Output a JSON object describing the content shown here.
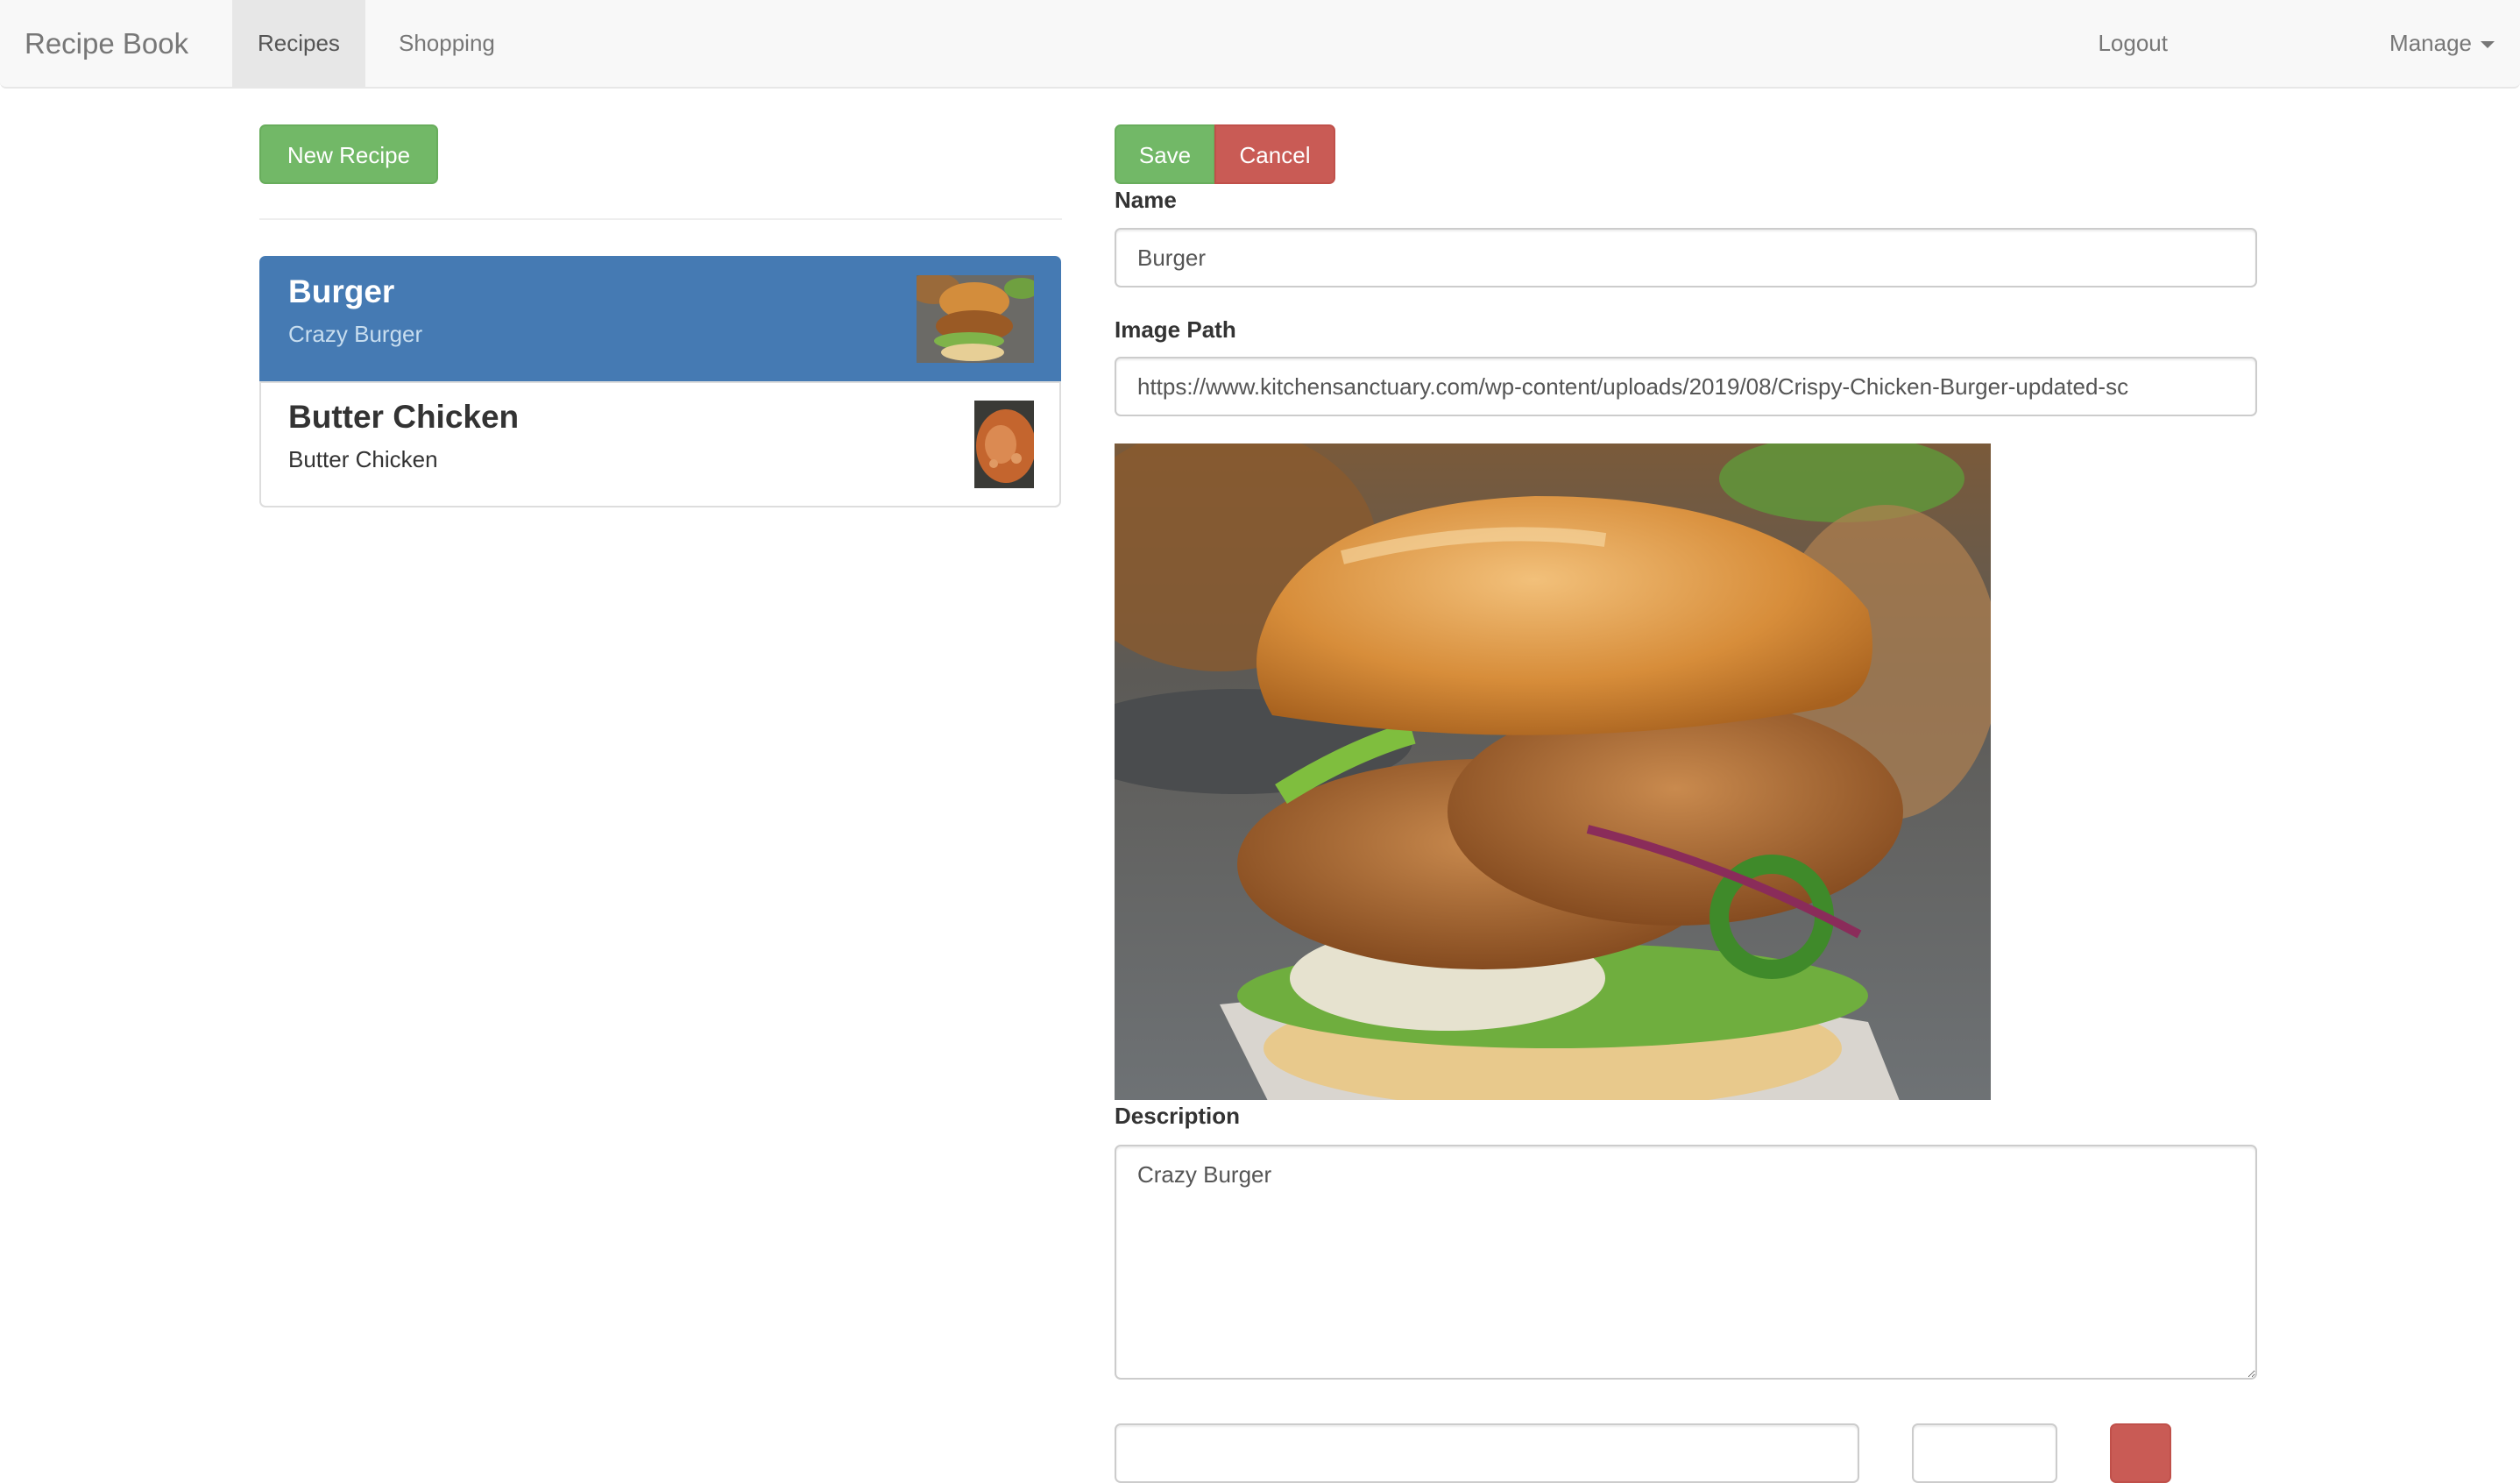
{
  "navbar": {
    "brand": "Recipe Book",
    "tabs": [
      {
        "label": "Recipes",
        "active": true
      },
      {
        "label": "Shopping",
        "active": false
      }
    ],
    "logout_label": "Logout",
    "manage_label": "Manage",
    "manage_icon": "caret-down-icon"
  },
  "left_panel": {
    "new_recipe_label": "New Recipe",
    "recipes": [
      {
        "name": "Burger",
        "description": "Crazy Burger",
        "active": true,
        "thumbnail": "burger-photo"
      },
      {
        "name": "Butter Chicken",
        "description": "Butter Chicken",
        "active": false,
        "thumbnail": "butter-chicken-photo"
      }
    ]
  },
  "editor": {
    "save_label": "Save",
    "cancel_label": "Cancel",
    "name_label": "Name",
    "name_value": "Burger",
    "image_path_label": "Image Path",
    "image_path_value": "https://www.kitchensanctuary.com/wp-content/uploads/2019/08/Crispy-Chicken-Burger-updated-sc",
    "image_preview": "burger-photo",
    "description_label": "Description",
    "description_value": "Crazy Burger",
    "ingredient_row": {
      "name_value": "",
      "amount_value": "",
      "delete_icon": "delete-icon"
    }
  },
  "colors": {
    "success": "#72b867",
    "danger": "#c95b55",
    "active_list": "#457ab3",
    "navbar_bg": "#f8f8f8"
  }
}
